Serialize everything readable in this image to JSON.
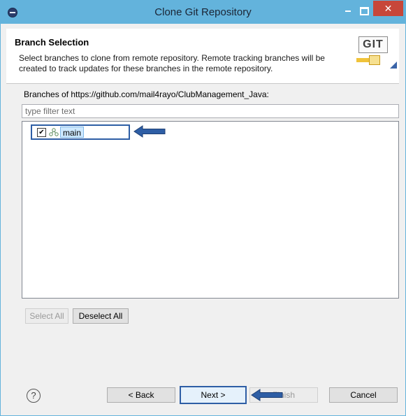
{
  "window": {
    "title": "Clone Git Repository",
    "close_glyph": "✕"
  },
  "header": {
    "title": "Branch Selection",
    "description": "Select branches to clone from remote repository. Remote tracking branches will be created to track updates for these branches in the remote repository.",
    "logo_text": "GIT"
  },
  "branches": {
    "label": "Branches of https://github.com/mail4rayo/ClubManagement_Java:",
    "filter_placeholder": "type filter text",
    "items": [
      {
        "name": "main",
        "checked": true
      }
    ]
  },
  "selection_buttons": {
    "select_all": "Select All",
    "deselect_all": "Deselect All"
  },
  "footer": {
    "help_glyph": "?",
    "back": "< Back",
    "next": "Next >",
    "finish": "Finish",
    "cancel": "Cancel"
  },
  "colors": {
    "titlebar": "#63b3dc",
    "close": "#c7473a",
    "annotation_arrow": "#2e5ea5"
  }
}
